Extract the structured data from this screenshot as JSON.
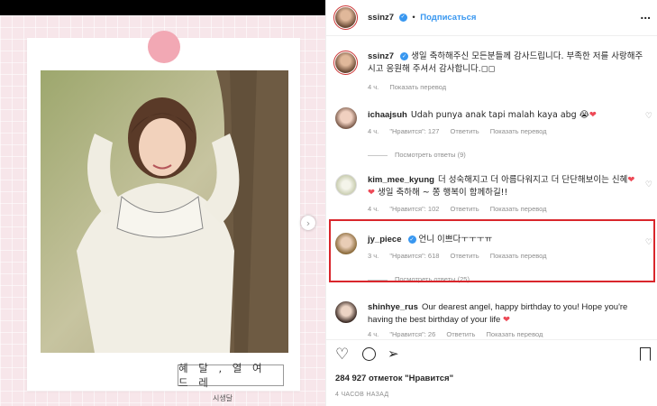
{
  "post": {
    "caption_main": "혜 달 ,   열 여 드 레",
    "caption_sub": "시생달"
  },
  "header": {
    "username": "ssinz7",
    "follow": "Подписаться",
    "more": "..."
  },
  "caption_comment": {
    "username": "ssinz7",
    "text": "생일 축하해주신 모든분들께 감사드립니다. 부족한 저를 사랑해주시고 응원해 주셔서 감사합니다.",
    "tail": "◻◻",
    "time": "4 ч.",
    "translate": "Показать перевод"
  },
  "comments": [
    {
      "username": "ichaajsuh",
      "text": "Udah punya anak tapi malah kaya abg",
      "emoji": "😭",
      "heart": "❤",
      "time": "4 ч.",
      "likes": "\"Нравится\": 127",
      "reply": "Ответить",
      "translate": "Показать перевод",
      "replies": "Посмотреть ответы (9)"
    },
    {
      "username": "kim_mee_kyung",
      "text": "더 성숙해지고 더 아름다워지고 더 단단해보이는 신혜",
      "hearts": "❤❤",
      "text2": "생일 축하해 ~ 쫑 행복이 함께하길!!",
      "time": "4 ч.",
      "likes": "\"Нравится\": 102",
      "reply": "Ответить",
      "translate": "Показать перевод"
    },
    {
      "username": "jy_piece",
      "text": "언니 이쁘다ㅜㅜㅜㅠ",
      "time": "3 ч.",
      "likes": "\"Нравится\": 618",
      "reply": "Ответить",
      "translate": "Показать перевод",
      "replies": "Посмотреть ответы (25)"
    },
    {
      "username": "shinhye_rus",
      "text": "Our dearest angel, happy birthday to you! Hope you're having the best birthday of your life",
      "heart": "❤",
      "time": "4 ч.",
      "likes": "\"Нравится\": 26",
      "reply": "Ответить",
      "translate": "Показать перевод"
    }
  ],
  "stats": {
    "likes": "284 927 отметок \"Нравится\"",
    "time_ago": "4 ЧАСОВ НАЗАД"
  },
  "colors": {
    "accent": "#3897f0",
    "highlight": "#d9262c",
    "heart": "#ed4956",
    "panel_bg": "#f7e6ea"
  }
}
